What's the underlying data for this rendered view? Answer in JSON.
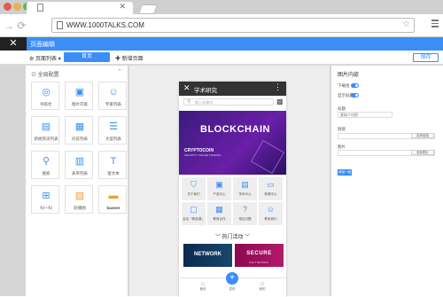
{
  "browser": {
    "url": "WWW.1000TALKS.COM",
    "tab_close": "✕"
  },
  "app": {
    "header_title": "页面编辑",
    "close_icon": "close-icon"
  },
  "toolbar": {
    "page_list": "⚙ 页面列表 ▾",
    "home": "首页",
    "new_page": "✚ 新增页面",
    "save": "保存",
    "accent": "#3a8ef6"
  },
  "left_panel": {
    "section": "全局配置",
    "components": [
      {
        "label": "导航栏",
        "icon": "nav-icon"
      },
      {
        "label": "图片内嵌",
        "icon": "image-icon"
      },
      {
        "label": "专家列表",
        "icon": "expert-icon"
      },
      {
        "label": "新闻资讯列表",
        "icon": "news-icon"
      },
      {
        "label": "问答列表",
        "icon": "qa-icon"
      },
      {
        "label": "文案列表",
        "icon": "text-list-icon"
      },
      {
        "label": "搜索",
        "icon": "search-icon"
      },
      {
        "label": "表单列表",
        "icon": "form-icon"
      },
      {
        "label": "富文本",
        "icon": "rich-text-icon"
      },
      {
        "label": "扫一扫",
        "icon": "scan-icon"
      },
      {
        "label": "轮播图",
        "icon": "carousel-icon"
      },
      {
        "label": "banner",
        "icon": "banner-icon"
      }
    ]
  },
  "phone": {
    "title": "学术研究",
    "search_placeholder": "输入关键词",
    "banner_title": "BLOCKCHAIN",
    "banner_brand": "CRYPTOCOIN",
    "banner_sub": "SECURITY ONLINE TRADING",
    "grid": [
      {
        "label": "关于我们"
      },
      {
        "label": "产品中心"
      },
      {
        "label": "学术中心"
      },
      {
        "label": "新闻中心"
      },
      {
        "label": "会议「精品课」"
      },
      {
        "label": "教育合作"
      },
      {
        "label": "常见问题"
      },
      {
        "label": "联系我们"
      }
    ],
    "hot_title": "热门活动",
    "card1": "NETWORK",
    "card2": "SECURE",
    "card2_sub": "NETWORK",
    "footer": {
      "home": "首页",
      "post": "发布",
      "mine": "我的"
    }
  },
  "right_panel": {
    "title": "图片内嵌",
    "row1": "下载组",
    "row2": "显示标题",
    "field_label": "标题",
    "field_value": "基础介绍图",
    "link_label": "链接",
    "link_button": "选择链接",
    "image_label": "图片",
    "image_button": "选择图片",
    "add_button": "添加一组"
  }
}
